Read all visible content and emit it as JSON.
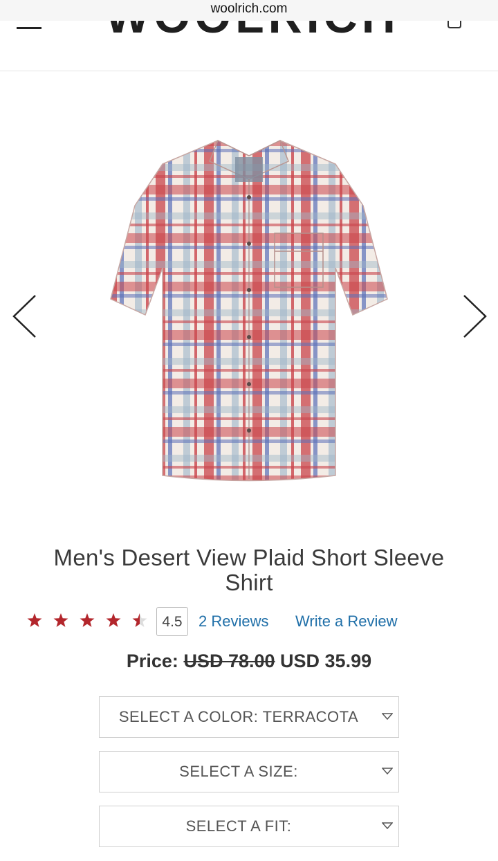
{
  "browser": {
    "url": "woolrich.com"
  },
  "header": {
    "brand": "WOOLRICH"
  },
  "product": {
    "title": "Men's Desert View Plaid Short Sleeve Shirt",
    "rating": "4.5",
    "rating_value": 4.5,
    "rating_max": 5,
    "reviews_label": "2 Reviews",
    "write_review_label": "Write a Review",
    "price_label": "Price:",
    "original_price": "USD 78.00",
    "sale_price": "USD 35.99"
  },
  "selectors": {
    "color": {
      "label": "SELECT A COLOR: TERRACOTA"
    },
    "size": {
      "label": "SELECT A SIZE:"
    },
    "fit": {
      "label": "SELECT A FIT:"
    }
  },
  "colors": {
    "star": "#b3262c",
    "link": "#1f6fa8"
  }
}
